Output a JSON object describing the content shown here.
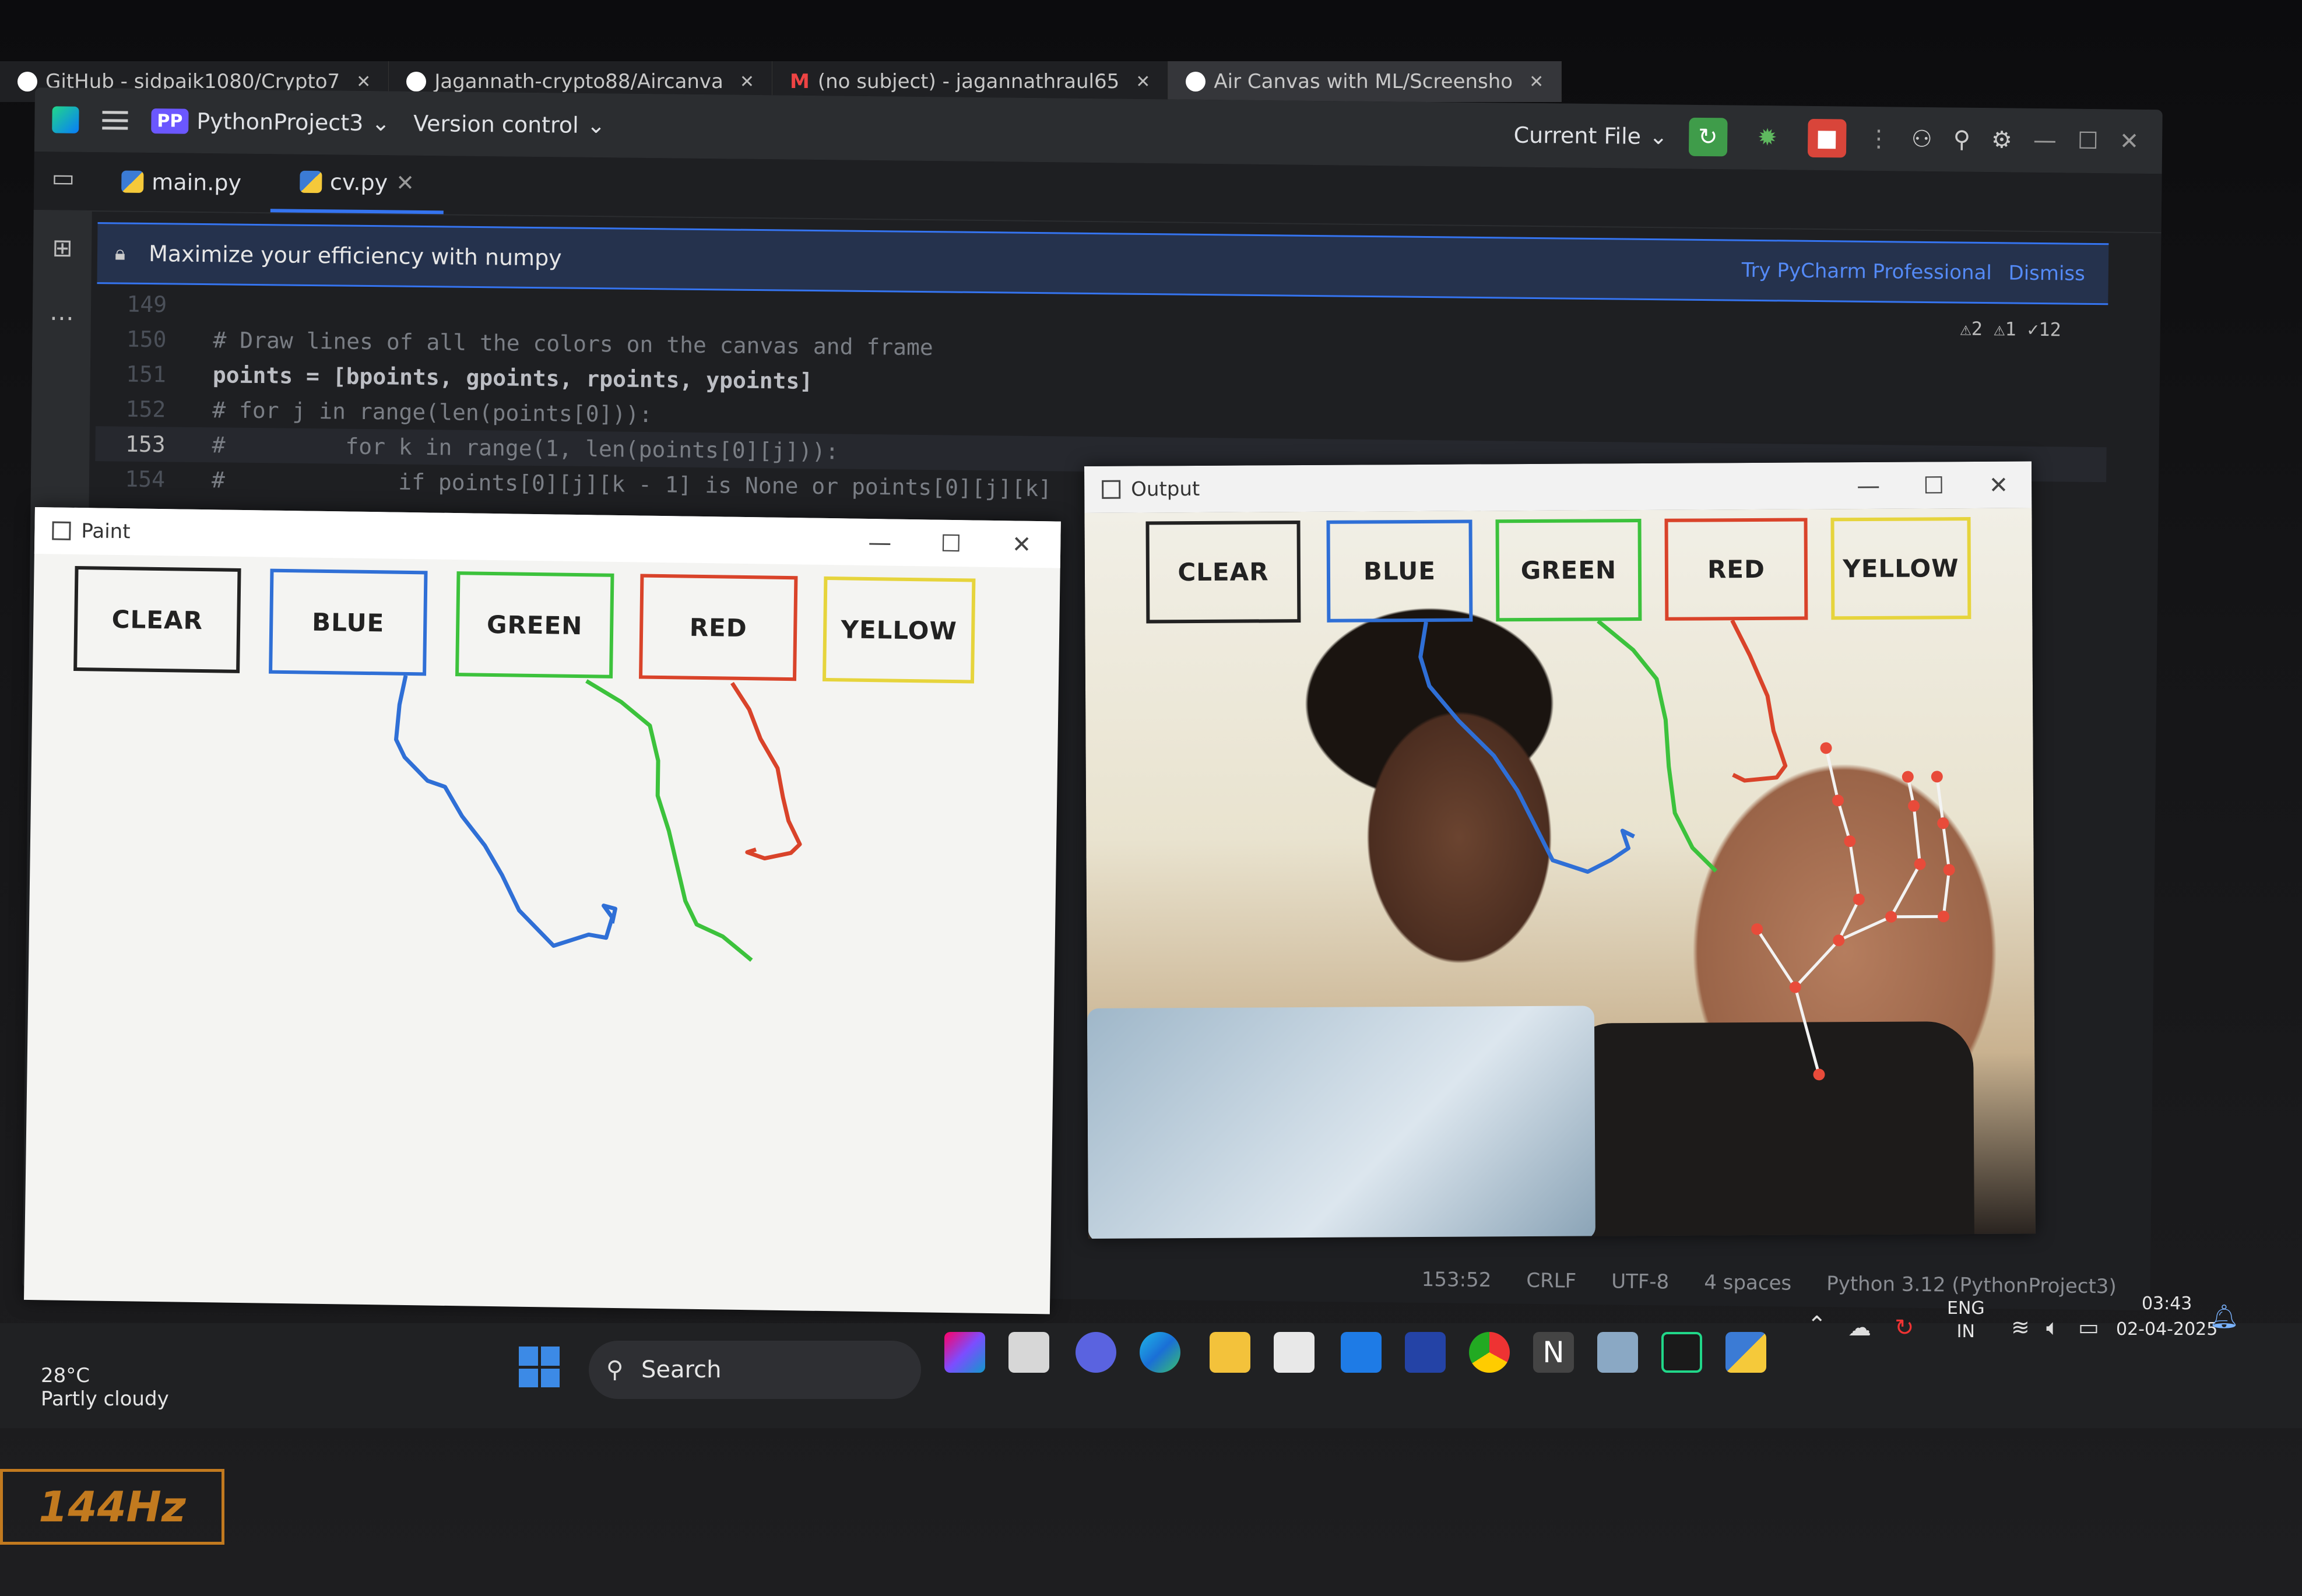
{
  "browser_tabs": [
    {
      "label": "GitHub - sidpaik1080/Crypto7",
      "icon": "github-icon"
    },
    {
      "label": "Jagannath-crypto88/Aircanva",
      "icon": "github-icon"
    },
    {
      "label": "(no subject) - jagannathraul65",
      "icon": "gmail-icon"
    },
    {
      "label": "Air Canvas with ML/Screensho",
      "icon": "github-icon"
    }
  ],
  "ide": {
    "project": "PythonProject3",
    "project_badge": "PP",
    "vcs": "Version control",
    "run_config": "Current File",
    "file_tabs": [
      {
        "label": "main.py",
        "active": false
      },
      {
        "label": "cv.py",
        "active": true
      }
    ],
    "banner": {
      "message": "Maximize your efficiency with numpy",
      "link_try": "Try PyCharm Professional",
      "link_dismiss": "Dismiss"
    },
    "inspections": "⚠2 ⚠1 ✓12",
    "code_lines": [
      {
        "n": "149",
        "text": ""
      },
      {
        "n": "150",
        "text": "# Draw lines of all the colors on the canvas and frame"
      },
      {
        "n": "151",
        "text": "points = [bpoints, gpoints, rpoints, ypoints]"
      },
      {
        "n": "152",
        "text": "# for j in range(len(points[0])):"
      },
      {
        "n": "153",
        "text": "#         for k in range(1, len(points[0][j])):"
      },
      {
        "n": "154",
        "text": "#             if points[0][j][k - 1] is None or points[0][j][k]"
      }
    ],
    "status": [
      "153:52",
      "CRLF",
      "UTF-8",
      "4 spaces",
      "Python 3.12 (PythonProject3)"
    ]
  },
  "paint_window": {
    "title": "Paint",
    "buttons": [
      {
        "label": "CLEAR",
        "color": "#222222"
      },
      {
        "label": "BLUE",
        "color": "#2f6fd6"
      },
      {
        "label": "GREEN",
        "color": "#3cc23c"
      },
      {
        "label": "RED",
        "color": "#d9432a"
      },
      {
        "label": "YELLOW",
        "color": "#e6d43c"
      }
    ]
  },
  "output_window": {
    "title": "Output",
    "buttons": [
      {
        "label": "CLEAR"
      },
      {
        "label": "BLUE"
      },
      {
        "label": "GREEN"
      },
      {
        "label": "RED"
      },
      {
        "label": "YELLOW"
      }
    ]
  },
  "taskbar": {
    "weather_temp": "28°C",
    "weather_desc": "Partly cloudy",
    "search_label": "Search",
    "lang_top": "ENG",
    "lang_bottom": "IN",
    "time": "03:43",
    "date": "02-04-2025"
  },
  "bezel_badge": "144Hz"
}
